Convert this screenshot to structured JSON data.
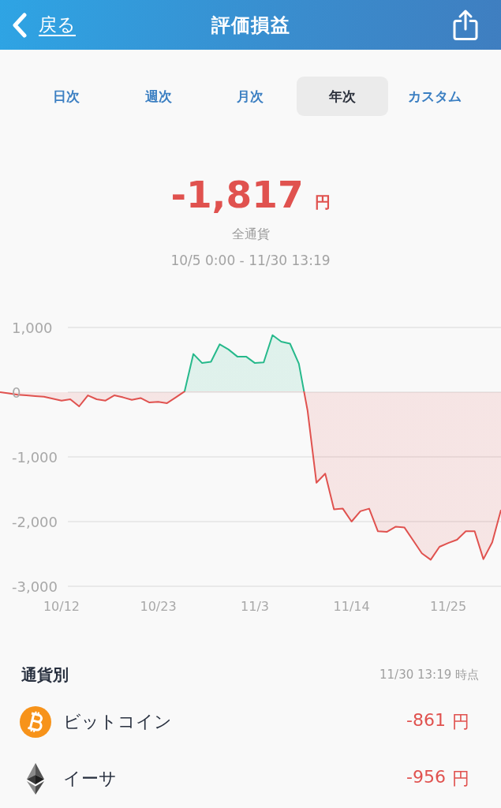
{
  "header": {
    "back_label": "戻る",
    "title": "評価損益"
  },
  "tabs": [
    {
      "label": "日次",
      "selected": false
    },
    {
      "label": "週次",
      "selected": false
    },
    {
      "label": "月次",
      "selected": false
    },
    {
      "label": "年次",
      "selected": true
    },
    {
      "label": "カスタム",
      "selected": false
    }
  ],
  "summary": {
    "amount": "-1,817",
    "unit": "円",
    "scope": "全通貨",
    "period": "10/5 0:00 - 11/30 13:19"
  },
  "chart": {
    "chart_data": {
      "type": "area",
      "categories": [
        null,
        null,
        null,
        null,
        null,
        null,
        null,
        "10/12",
        null,
        null,
        null,
        null,
        null,
        null,
        null,
        null,
        null,
        null,
        "10/23",
        null,
        null,
        null,
        null,
        null,
        null,
        null,
        null,
        null,
        null,
        "11/3",
        null,
        null,
        null,
        null,
        null,
        null,
        null,
        null,
        null,
        null,
        "11/14",
        null,
        null,
        null,
        null,
        null,
        null,
        null,
        null,
        null,
        null,
        "11/25",
        null,
        null,
        null,
        null,
        null,
        null
      ],
      "series": [
        {
          "color": "#e0524f",
          "values": [
            0,
            -20,
            -40,
            -50,
            -60,
            -70,
            -100,
            -130,
            -110,
            -220,
            -50,
            -110,
            -130,
            -50,
            -80,
            -120,
            -90,
            -160,
            -150,
            -170,
            -80,
            10,
            590,
            450,
            470,
            740,
            660,
            550,
            550,
            450,
            460,
            880,
            780,
            750,
            440,
            -290,
            -1400,
            -1260,
            -1810,
            -1800,
            -2000,
            -1840,
            -1800,
            -2150,
            -2160,
            -2080,
            -2090,
            -2290,
            -2490,
            -2590,
            -2390,
            -2330,
            -2280,
            -2150,
            -2150,
            -2580,
            -2320,
            -1820
          ]
        }
      ],
      "ylim": [
        -3000,
        1000
      ],
      "yticks": [
        {
          "value": 1000,
          "label": "1,000"
        },
        {
          "value": 0,
          "label": "0"
        },
        {
          "value": -1000,
          "label": "-1,000"
        },
        {
          "value": -2000,
          "label": "-2,000"
        },
        {
          "value": -3000,
          "label": "-3,000"
        }
      ],
      "grid": true
    }
  },
  "breakdown": {
    "title": "通貨別",
    "as_of": "11/30 13:19 時点",
    "items": [
      {
        "kind": "btc",
        "name": "ビットコイン",
        "amount": "-861",
        "unit": "円"
      },
      {
        "kind": "eth",
        "name": "イーサ",
        "amount": "-956",
        "unit": "円"
      }
    ]
  }
}
